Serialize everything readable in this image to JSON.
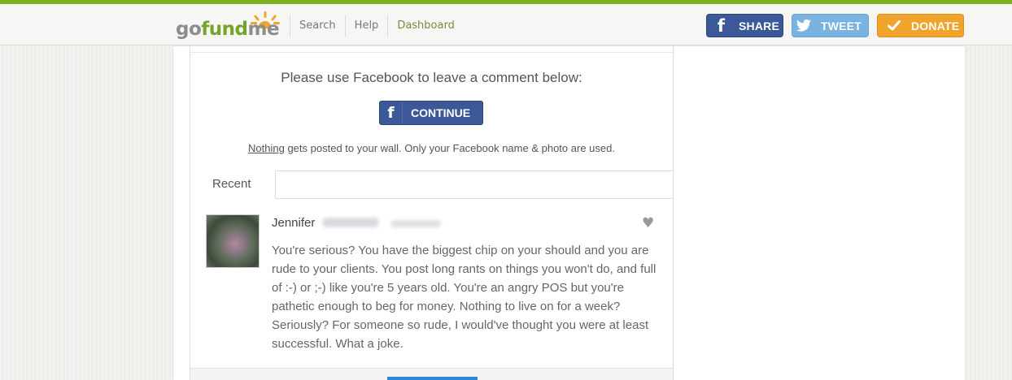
{
  "header": {
    "logo": {
      "go": "go",
      "fund": "fund",
      "me": "me"
    },
    "nav": [
      "Search",
      "Help",
      "Dashboard"
    ],
    "share_label": "SHARE",
    "tweet_label": "TWEET",
    "donate_label": "DONATE",
    "colors": {
      "stripe": "#7eb11e",
      "share": "#3b5998",
      "tweet": "#7ab3e0",
      "donate": "#f1a42d"
    }
  },
  "facebook": {
    "prompt": "Please use Facebook to leave a comment below:",
    "continue_label": "CONTINUE",
    "note_underlined": "Nothing",
    "note_rest": " gets posted to your wall. Only your Facebook name & photo are used."
  },
  "tabs": {
    "recent": "Recent"
  },
  "comments": [
    {
      "name": "Jennifer",
      "text": "You're serious? You have the biggest chip on your should and you are rude to your clients. You post long rants on things you won't do, and full of :-) or ;-) like you're 5 years old. You're an angry POS but you're pathetic enough to beg for money. Nothing to live on for a week? Seriously? For someone so rude, I would've thought you were at least successful. What a joke."
    }
  ],
  "icons": {
    "facebook": "facebook-f-icon",
    "twitter": "twitter-bird-icon",
    "donate": "check-icon",
    "like": "heart-icon",
    "logo": "sun-icon"
  }
}
